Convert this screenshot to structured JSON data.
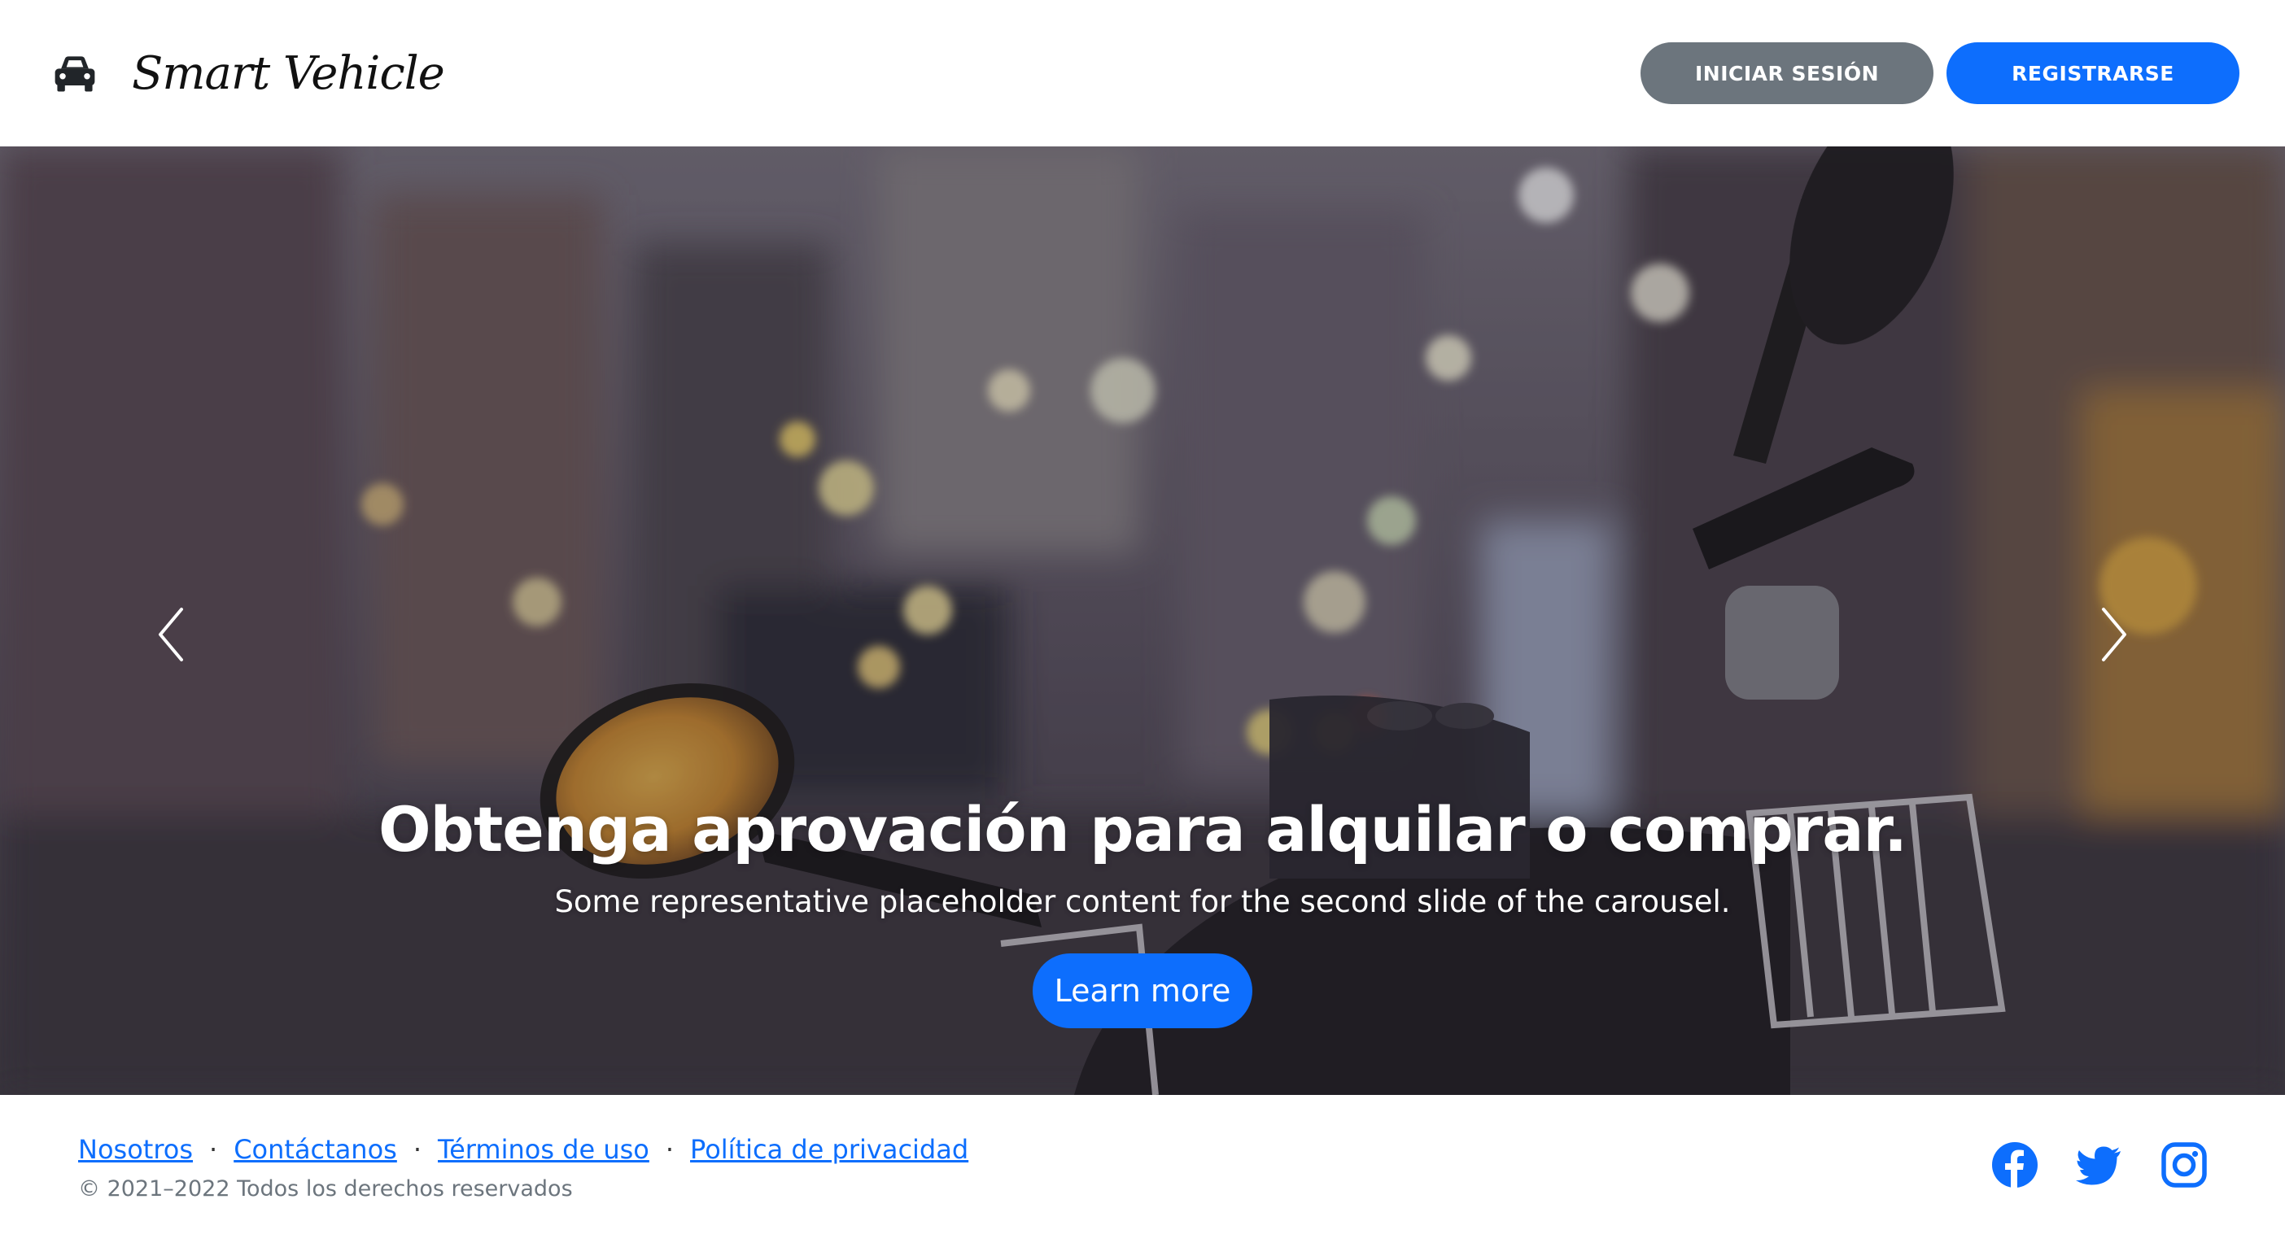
{
  "header": {
    "brand_name": "Smart Vehicle",
    "brand_icon": "car-icon",
    "login_label": "INICIAR SESIÓN",
    "register_label": "REGISTRARSE"
  },
  "carousel": {
    "active_slide": 2,
    "title": "Obtenga aprovación para alquilar o comprar.",
    "text": "Some representative placeholder content for the second slide of the carousel.",
    "button_label": "Learn more",
    "prev_icon": "chevron-left-icon",
    "next_icon": "chevron-right-icon"
  },
  "footer": {
    "links": [
      "Nosotros",
      "Contáctanos",
      "Términos de uso",
      "Política de privacidad"
    ],
    "separator": "·",
    "copyright": "© 2021–2022 Todos los derechos reservados",
    "social": [
      "facebook-icon",
      "twitter-icon",
      "instagram-icon"
    ]
  },
  "colors": {
    "primary": "#0d6efd",
    "secondary": "#6c757d",
    "text_muted": "#6c757d"
  }
}
